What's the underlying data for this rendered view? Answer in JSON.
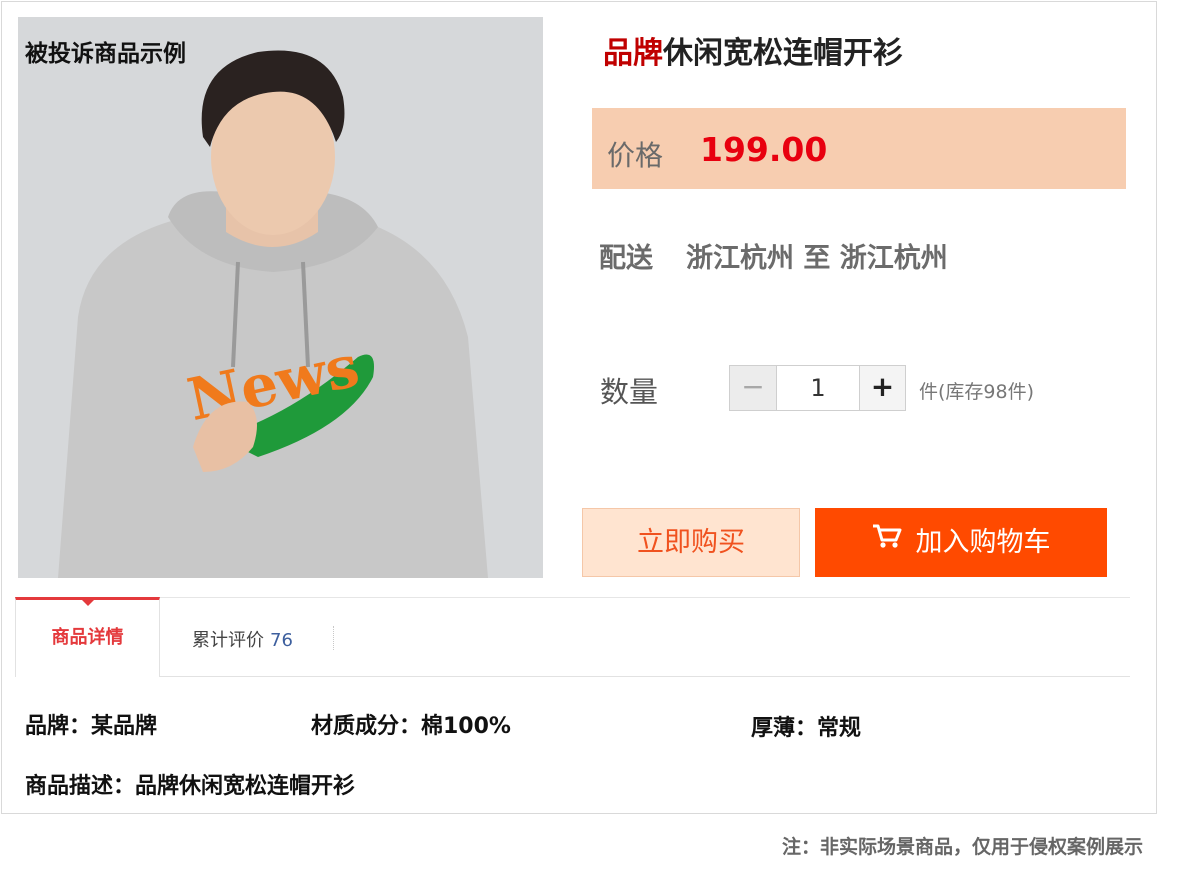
{
  "photo": {
    "caption": "被投诉商品示例",
    "shirt_print": "News",
    "colors": {
      "background": "#d4d6d8",
      "hoodie": "#c9c9c9",
      "print_orange": "#f07a1c",
      "print_green": "#1f9a3a"
    }
  },
  "product": {
    "brand_word": "品牌",
    "name_rest": "休闲宽松连帽开衫"
  },
  "price": {
    "label": "价格",
    "value": "199.00"
  },
  "shipping": {
    "label": "配送",
    "route": "浙江杭州 至 浙江杭州"
  },
  "quantity": {
    "label": "数量",
    "minus": "−",
    "value": "1",
    "plus": "+",
    "stock": "件(库存98件)"
  },
  "buttons": {
    "buy_now": "立即购买",
    "add_to_cart": "加入购物车",
    "cart_icon": "shopping-cart-icon"
  },
  "tabs": {
    "details": "商品详情",
    "reviews": "累计评价",
    "review_count": "76"
  },
  "specs": {
    "brand": "品牌：某品牌",
    "material": "材质成分：棉100%",
    "thickness": "厚薄：常规",
    "description": "商品描述：品牌休闲宽松连帽开衫"
  },
  "footnote": "注：非实际场景商品，仅用于侵权案例展示",
  "colors": {
    "accent_red": "#e8000f",
    "buy_now_bg": "#ffe4d0",
    "add_cart_bg": "#ff4a00",
    "price_bar_bg": "#f7cdb0",
    "tab_active": "#e4393c"
  }
}
